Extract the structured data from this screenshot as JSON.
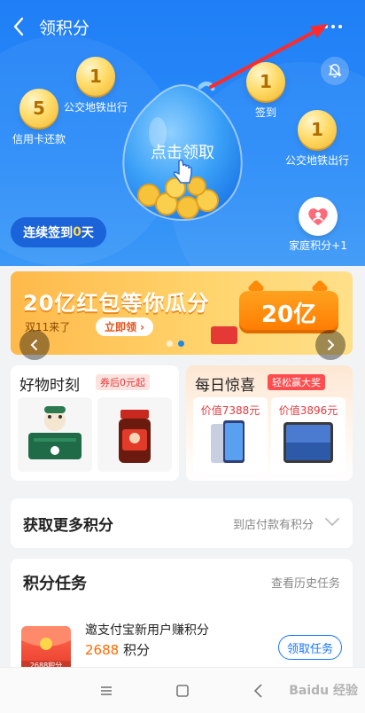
{
  "header": {
    "title": "领积分"
  },
  "coins": [
    {
      "value": "1",
      "label": "公交地铁出行"
    },
    {
      "value": "5",
      "label": "信用卡还款"
    },
    {
      "value": "1",
      "label": "签到"
    },
    {
      "value": "1",
      "label": "公交地铁出行"
    }
  ],
  "drop": {
    "label": "点击领取"
  },
  "streak": {
    "prefix": "连续签到",
    "days": "0",
    "suffix": "天"
  },
  "family": {
    "label": "家庭积分+1"
  },
  "banner": {
    "title": "20亿红包等你瓜分",
    "subtitle": "双11来了",
    "cta": "立即领 ›",
    "badge": "20亿"
  },
  "cards": {
    "left": {
      "title": "好物时刻",
      "tag": "券后0元起"
    },
    "right": {
      "title": "每日惊喜",
      "tag": "轻松赢大奖",
      "items": [
        {
          "price": "价值7388元"
        },
        {
          "price": "价值3896元"
        }
      ]
    }
  },
  "more": {
    "title": "获取更多积分",
    "right": "到店付款有积分"
  },
  "tasks": {
    "title": "积分任务",
    "history": "查看历史任务",
    "item": {
      "name": "邀支付宝新用户赚积分",
      "points": "2688",
      "unit": "积分",
      "icon_label": "2688积分",
      "button": "领取任务"
    }
  },
  "watermark": "Baidu 经验",
  "colors": {
    "primary": "#1f7ef6",
    "accent": "#ff6a00",
    "link": "#1677ff"
  }
}
